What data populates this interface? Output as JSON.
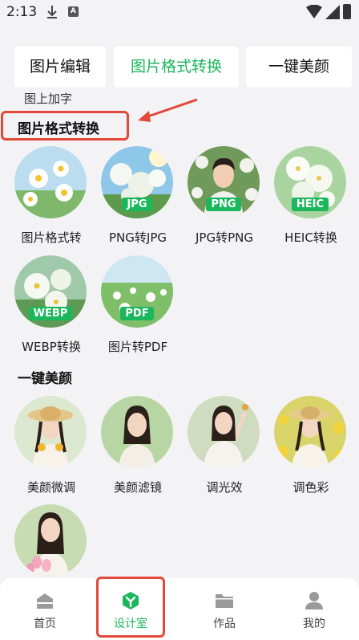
{
  "status_bar": {
    "time": "2:13",
    "a_badge": "A"
  },
  "tabs": [
    {
      "label": "图片编辑",
      "active": false
    },
    {
      "label": "图片格式转换",
      "active": true
    },
    {
      "label": "一键美颜",
      "active": false
    }
  ],
  "subtext": "图上加字",
  "sections": [
    {
      "title": "图片格式转换",
      "items": [
        {
          "label": "图片格式转",
          "badge": "",
          "icon": "daisy-photo-icon"
        },
        {
          "label": "PNG转JPG",
          "badge": "JPG",
          "icon": "white-flowers-photo-icon"
        },
        {
          "label": "JPG转PNG",
          "badge": "PNG",
          "icon": "man-portrait-photo-icon"
        },
        {
          "label": "HEIC转换",
          "badge": "HEIC",
          "icon": "white-blossom-photo-icon"
        },
        {
          "label": "WEBP转换",
          "badge": "WEBP",
          "icon": "white-flowers-photo-icon"
        },
        {
          "label": "图片转PDF",
          "badge": "PDF",
          "icon": "flower-field-photo-icon"
        }
      ]
    },
    {
      "title": "一键美颜",
      "items": [
        {
          "label": "美颜微调",
          "icon": "girl-straw-hat-photo-icon"
        },
        {
          "label": "美颜滤镜",
          "icon": "girl-portrait-photo-icon"
        },
        {
          "label": "调光效",
          "icon": "girl-white-dress-photo-icon"
        },
        {
          "label": "调色彩",
          "icon": "girl-yellow-flowers-photo-icon"
        },
        {
          "label": "",
          "icon": "girl-pink-tulips-photo-icon"
        }
      ]
    }
  ],
  "bottom_nav": [
    {
      "label": "首页",
      "icon": "home-icon",
      "active": false
    },
    {
      "label": "设计室",
      "icon": "design-studio-icon",
      "active": true
    },
    {
      "label": "作品",
      "icon": "folder-icon",
      "active": false
    },
    {
      "label": "我的",
      "icon": "user-icon",
      "active": false
    }
  ],
  "colors": {
    "accent": "#1bb75c",
    "highlight": "#e2493b",
    "background": "#f3f3f5"
  }
}
